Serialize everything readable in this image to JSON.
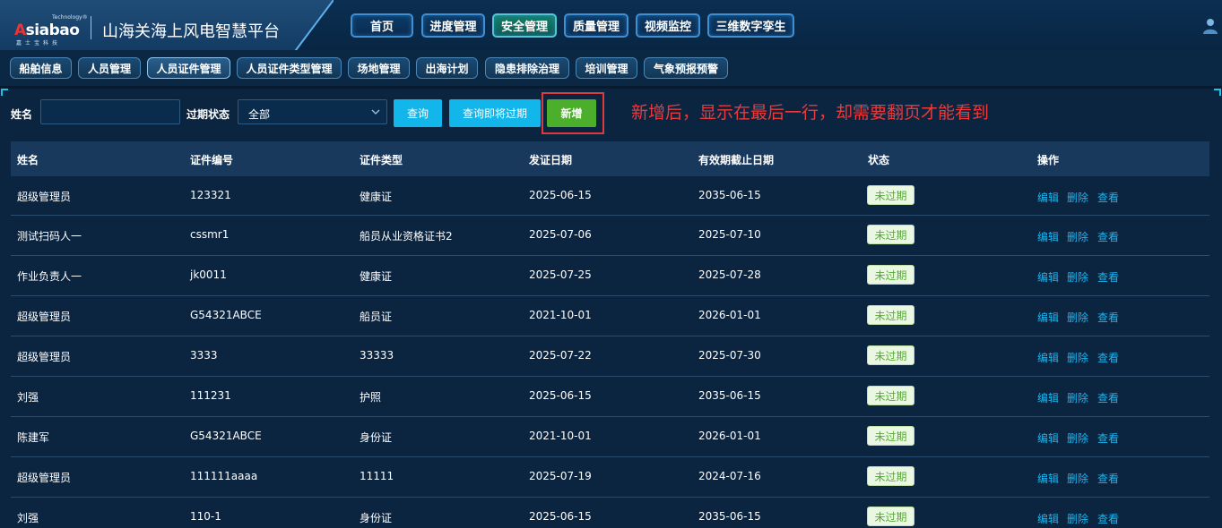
{
  "header": {
    "logo": {
      "tech": "Technology®",
      "word_a": "A",
      "word_rest": "siabao",
      "sub": "嘉士宝科技"
    },
    "title": "山海关海上风电智慧平台",
    "nav": [
      {
        "label": "首页",
        "active": false
      },
      {
        "label": "进度管理",
        "active": false
      },
      {
        "label": "安全管理",
        "active": true
      },
      {
        "label": "质量管理",
        "active": false
      },
      {
        "label": "视频监控",
        "active": false
      },
      {
        "label": "三维数字孪生",
        "active": false
      }
    ]
  },
  "subnav": [
    {
      "label": "船舶信息",
      "active": false
    },
    {
      "label": "人员管理",
      "active": false
    },
    {
      "label": "人员证件管理",
      "active": true
    },
    {
      "label": "人员证件类型管理",
      "active": false
    },
    {
      "label": "场地管理",
      "active": false
    },
    {
      "label": "出海计划",
      "active": false
    },
    {
      "label": "隐患排除治理",
      "active": false
    },
    {
      "label": "培训管理",
      "active": false
    },
    {
      "label": "气象预报预警",
      "active": false
    }
  ],
  "filters": {
    "name_label": "姓名",
    "name_value": "",
    "expiry_label": "过期状态",
    "expiry_value": "全部",
    "query_button": "查询",
    "query_expiring_button": "查询即将过期",
    "add_button": "新增"
  },
  "annotation": "新增后，显示在最后一行，却需要翻页才能看到",
  "table": {
    "headers": [
      "姓名",
      "证件编号",
      "证件类型",
      "发证日期",
      "有效期截止日期",
      "状态",
      "操作"
    ],
    "rows": [
      {
        "name": "超级管理员",
        "cert_no": "123321",
        "cert_type": "健康证",
        "issue_date": "2025-06-15",
        "expiry_date": "2035-06-15",
        "status": "未过期"
      },
      {
        "name": "测试扫码人一",
        "cert_no": "cssmr1",
        "cert_type": "船员从业资格证书2",
        "issue_date": "2025-07-06",
        "expiry_date": "2025-07-10",
        "status": "未过期"
      },
      {
        "name": "作业负责人一",
        "cert_no": "jk0011",
        "cert_type": "健康证",
        "issue_date": "2025-07-25",
        "expiry_date": "2025-07-28",
        "status": "未过期"
      },
      {
        "name": "超级管理员",
        "cert_no": "G54321ABCE",
        "cert_type": "船员证",
        "issue_date": "2021-10-01",
        "expiry_date": "2026-01-01",
        "status": "未过期"
      },
      {
        "name": "超级管理员",
        "cert_no": "3333",
        "cert_type": "33333",
        "issue_date": "2025-07-22",
        "expiry_date": "2025-07-30",
        "status": "未过期"
      },
      {
        "name": "刘强",
        "cert_no": "111231",
        "cert_type": "护照",
        "issue_date": "2025-06-15",
        "expiry_date": "2035-06-15",
        "status": "未过期"
      },
      {
        "name": "陈建军",
        "cert_no": "G54321ABCE",
        "cert_type": "身份证",
        "issue_date": "2021-10-01",
        "expiry_date": "2026-01-01",
        "status": "未过期"
      },
      {
        "name": "超级管理员",
        "cert_no": "111111aaaa",
        "cert_type": "11111",
        "issue_date": "2025-07-19",
        "expiry_date": "2024-07-16",
        "status": "未过期"
      },
      {
        "name": "刘强",
        "cert_no": "110-1",
        "cert_type": "身份证",
        "issue_date": "2025-06-15",
        "expiry_date": "2035-06-15",
        "status": "未过期"
      }
    ],
    "actions": {
      "edit": "编辑",
      "delete": "删除",
      "view": "查看"
    }
  },
  "colors": {
    "accent": "#12b6ea",
    "add_green": "#4caf2b",
    "annotation_red": "#ec3a3a",
    "status_green": "#5aa83a"
  }
}
